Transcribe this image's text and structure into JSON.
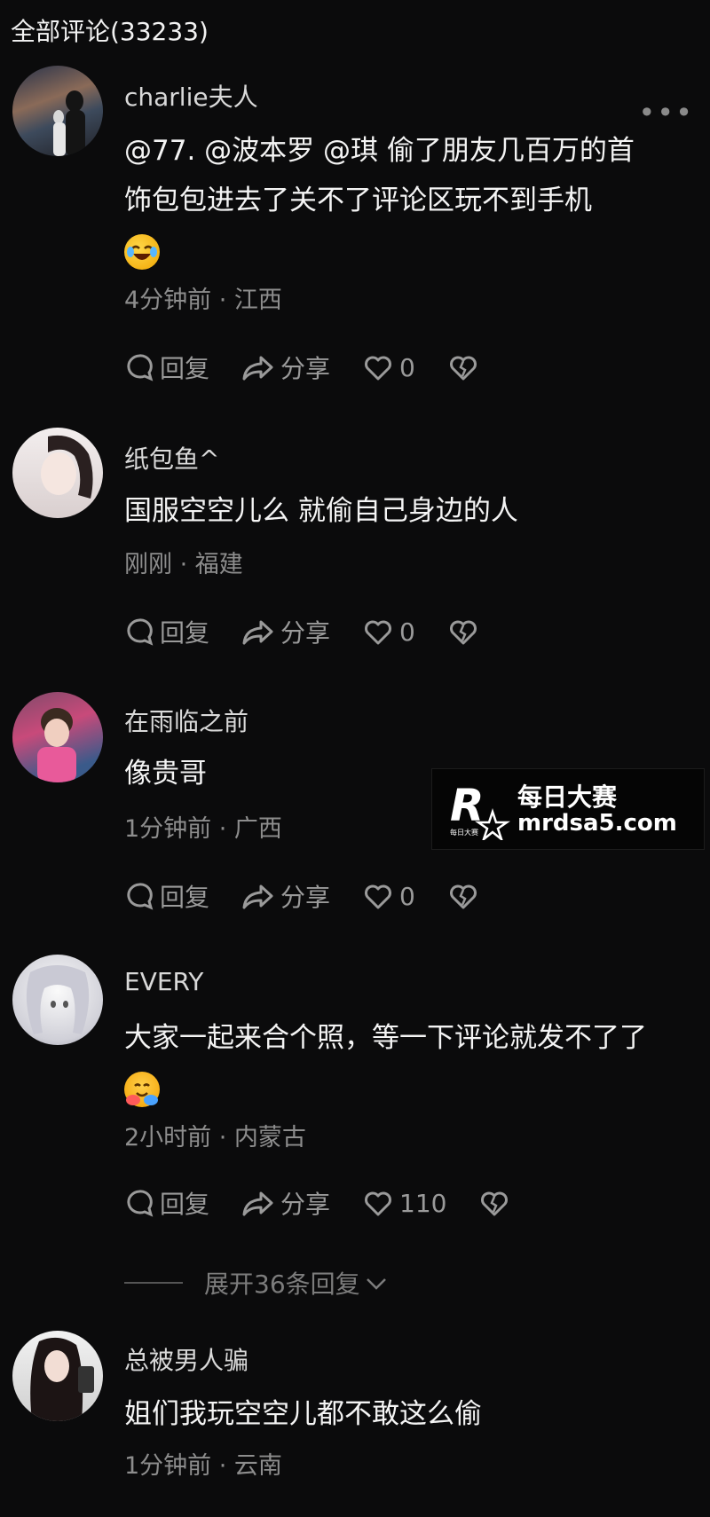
{
  "header": {
    "title": "全部评论(33233)"
  },
  "comments": [
    {
      "username": "charlie夫人",
      "text_line1": "@77. @波本罗 @琪 偷了朋友几百万的首",
      "text_line2": "饰包包进去了关不了评论区玩不到手机",
      "emoji": "laughing-face-emoji",
      "meta": "4分钟前 · 江西",
      "reply_label": "回复",
      "share_label": "分享",
      "like_count": "0",
      "has_more_menu": true
    },
    {
      "username": "纸包鱼^",
      "text_line1": "国服空空儿么 就偷自己身边的人",
      "meta": "刚刚 · 福建",
      "reply_label": "回复",
      "share_label": "分享",
      "like_count": "0"
    },
    {
      "username": "在雨临之前",
      "text_line1": "像贵哥",
      "meta": "1分钟前 · 广西",
      "reply_label": "回复",
      "share_label": "分享",
      "like_count": "0"
    },
    {
      "username": "EVERY",
      "text_line1": "大家一起来合个照，等一下评论就发不了了",
      "emoji": "hugging-face-emoji",
      "meta": "2小时前 · 内蒙古",
      "reply_label": "回复",
      "share_label": "分享",
      "like_count": "110"
    },
    {
      "username": "总被男人骗",
      "text_line1": "姐们我玩空空儿都不敢这么偷",
      "meta": "1分钟前 · 云南"
    }
  ],
  "expand_replies": {
    "label": "展开36条回复"
  },
  "watermark": {
    "chinese": "每日大赛",
    "url": "mrdsa5.com",
    "logo_small_text": "每日大赛"
  },
  "colors": {
    "background": "#0b0b0c",
    "text_primary": "#f4f4f4",
    "text_secondary": "#8d8d8d"
  }
}
